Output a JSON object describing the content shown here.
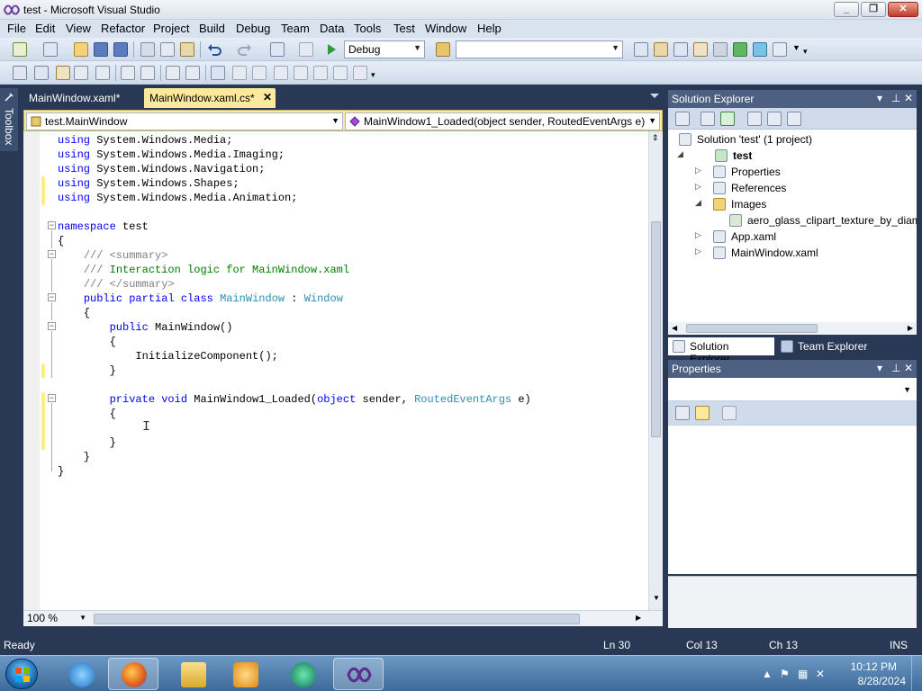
{
  "window": {
    "title": "test - Microsoft Visual Studio",
    "minimize": "_",
    "maximize": "❐",
    "close": "✕"
  },
  "menu": [
    "File",
    "Edit",
    "View",
    "Refactor",
    "Project",
    "Build",
    "Debug",
    "Team",
    "Data",
    "Tools",
    "Test",
    "Window",
    "Help"
  ],
  "toolbar": {
    "config": "Debug",
    "platform": ""
  },
  "toolbox_label": "Toolbox",
  "tabs": [
    {
      "label": "MainWindow.xaml*",
      "active": false
    },
    {
      "label": "MainWindow.xaml.cs*",
      "active": true
    }
  ],
  "nav": {
    "class_combo": "test.MainWindow",
    "member_combo": "MainWindow1_Loaded(object sender, RoutedEventArgs e)"
  },
  "code_lines": [
    "using System.Windows.Media;",
    "using System.Windows.Media.Imaging;",
    "using System.Windows.Navigation;",
    "using System.Windows.Shapes;",
    "using System.Windows.Media.Animation;",
    "",
    "namespace test",
    "{",
    "    /// <summary>",
    "    /// Interaction logic for MainWindow.xaml",
    "    /// </summary>",
    "    public partial class MainWindow : Window",
    "    {",
    "        public MainWindow()",
    "        {",
    "            InitializeComponent();",
    "        }",
    "",
    "        private void MainWindow1_Loaded(object sender, RoutedEventArgs e)",
    "        {",
    "",
    "        }",
    "    }",
    "}"
  ],
  "editor": {
    "zoom": "100 %"
  },
  "solution_explorer": {
    "title": "Solution Explorer",
    "items": [
      {
        "label": "Solution 'test' (1 project)",
        "expander": ""
      },
      {
        "label": "test",
        "expander": "◢"
      },
      {
        "label": "Properties",
        "expander": "▷"
      },
      {
        "label": "References",
        "expander": "▷"
      },
      {
        "label": "Images",
        "expander": "◢"
      },
      {
        "label": "aero_glass_clipart_texture_by_diamo",
        "expander": ""
      },
      {
        "label": "App.xaml",
        "expander": "▷"
      },
      {
        "label": "MainWindow.xaml",
        "expander": "▷"
      }
    ],
    "tabs": [
      "Solution Explorer",
      "Team Explorer"
    ]
  },
  "properties": {
    "title": "Properties"
  },
  "status": {
    "ready": "Ready",
    "ln": "Ln 30",
    "col": "Col 13",
    "ch": "Ch 13",
    "ins": "INS"
  },
  "clock": {
    "time": "10:12 PM",
    "date": "8/28/2024"
  },
  "colors": {
    "keyword": "#0000ff",
    "type": "#2b91af",
    "comment": "#008000",
    "active_tab": "#fde99e",
    "chrome": "#293955"
  },
  "taskbar_apps": [
    "internet-explorer",
    "firefox",
    "file-explorer",
    "media-player",
    "media-center",
    "visual-studio"
  ]
}
